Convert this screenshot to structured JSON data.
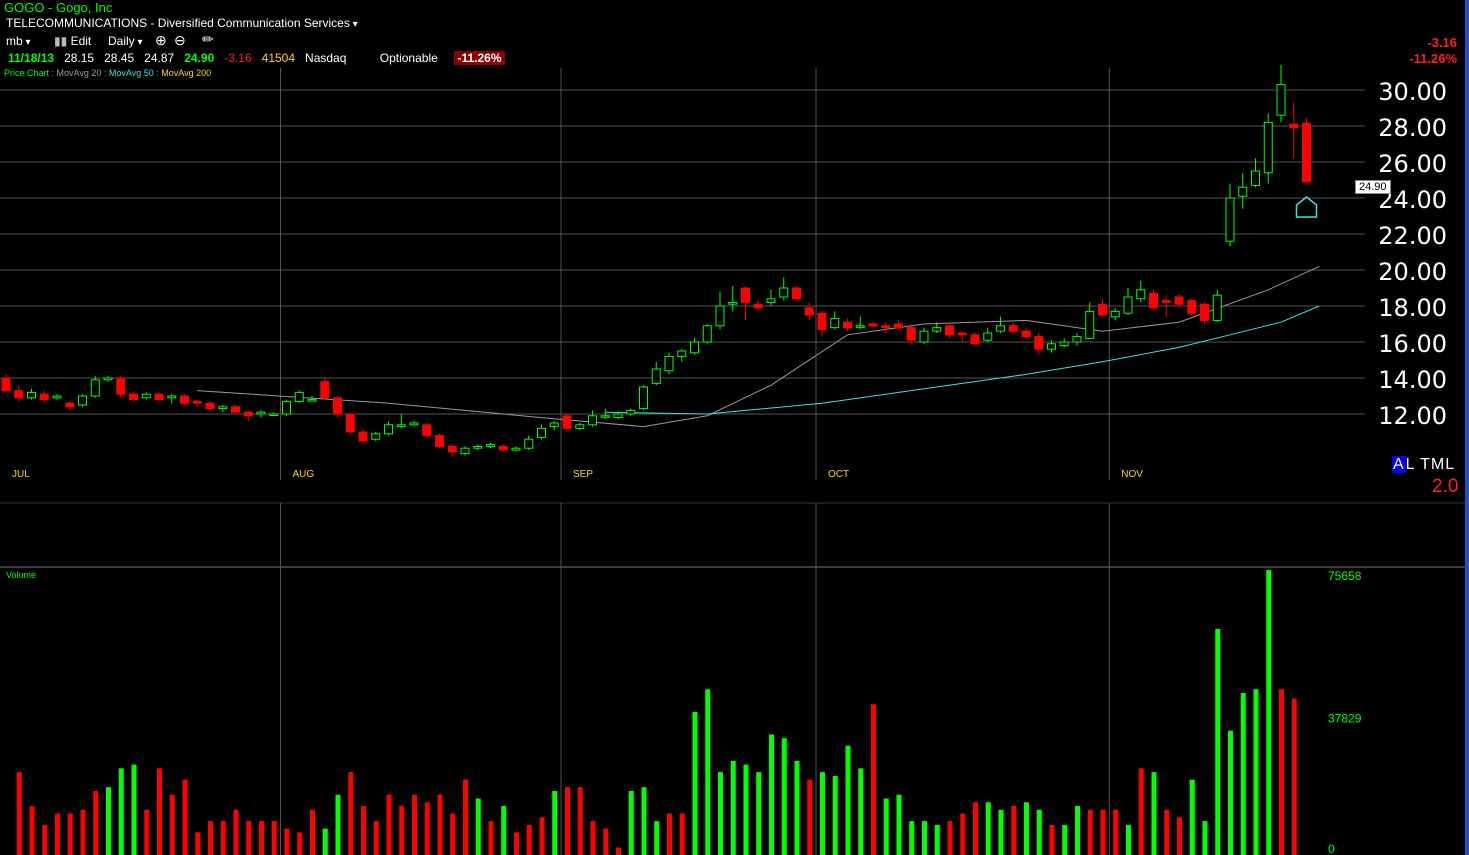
{
  "header": {
    "title": "GOGO - Gogo, Inc",
    "sector": "TELECOMMUNICATIONS - Diversified Communication Services",
    "user": "mb",
    "edit_label": "Edit",
    "interval": "Daily",
    "date": "11/18/13",
    "open": "28.15",
    "high": "28.45",
    "low": "24.87",
    "close": "24.90",
    "change": "-3.16",
    "volume": "41504",
    "exchange": "Nasdaq",
    "optionable": "Optionable",
    "pct_change": "-11.26%"
  },
  "legend": {
    "price_chart": "Price Chart",
    "ma20": "MovAvg 20",
    "ma50": "MovAvg 50",
    "ma200": "MovAvg 200",
    "volume": "Volume"
  },
  "right_panel": {
    "change": "-3.16",
    "pct_change": "-11.26%",
    "last_price_tag": "24.90",
    "altml_a": "A",
    "altml_rest": "L TML",
    "altml_value": "2.0"
  },
  "colors": {
    "up": "#00ff00",
    "down": "#ff0000",
    "ma20": "#9a9a9a",
    "ma50": "#40e0e0",
    "grid": "#555555"
  },
  "chart_data": {
    "type": "candlestick",
    "price_axis": {
      "ylim": [
        10.6,
        31.6
      ],
      "ticks": [
        "30.00",
        "28.00",
        "26.00",
        "24.00",
        "22.00",
        "20.00",
        "18.00",
        "16.00",
        "14.00",
        "12.00"
      ]
    },
    "volume_axis": {
      "ylim": [
        0,
        75658
      ],
      "ticks": [
        "75658",
        "37829",
        "0"
      ]
    },
    "months": [
      {
        "label": "JUL",
        "index": 0
      },
      {
        "label": "AUG",
        "index": 22
      },
      {
        "label": "SEP",
        "index": 44
      },
      {
        "label": "OCT",
        "index": 64
      },
      {
        "label": "NOV",
        "index": 87
      }
    ],
    "candles": [
      [
        14.0,
        13.3,
        14.2,
        13.2
      ],
      [
        13.3,
        12.9,
        13.6,
        12.7
      ],
      [
        12.9,
        13.2,
        13.4,
        12.8
      ],
      [
        13.1,
        12.8,
        13.3,
        12.6
      ],
      [
        12.9,
        13.0,
        13.1,
        12.8
      ],
      [
        12.6,
        12.4,
        12.7,
        12.2
      ],
      [
        12.5,
        13.0,
        13.1,
        12.4
      ],
      [
        13.0,
        13.9,
        14.1,
        12.9
      ],
      [
        13.9,
        14.0,
        14.1,
        13.8
      ],
      [
        14.0,
        13.1,
        14.1,
        12.9
      ],
      [
        13.1,
        12.8,
        13.2,
        12.7
      ],
      [
        12.9,
        13.1,
        13.2,
        12.8
      ],
      [
        13.1,
        12.8,
        13.2,
        12.7
      ],
      [
        12.9,
        13.0,
        13.1,
        12.6
      ],
      [
        13.0,
        12.6,
        13.1,
        12.5
      ],
      [
        12.7,
        12.6,
        12.8,
        12.4
      ],
      [
        12.6,
        12.3,
        12.7,
        12.2
      ],
      [
        12.3,
        12.4,
        12.5,
        12.1
      ],
      [
        12.4,
        12.1,
        12.5,
        12.0
      ],
      [
        12.1,
        11.9,
        12.2,
        11.6
      ],
      [
        12.0,
        12.1,
        12.2,
        11.8
      ],
      [
        12.0,
        12.0,
        12.1,
        11.9
      ],
      [
        12.0,
        12.7,
        12.8,
        11.9
      ],
      [
        12.7,
        13.2,
        13.3,
        12.6
      ],
      [
        12.8,
        12.8,
        13.0,
        12.7
      ],
      [
        13.8,
        12.9,
        14.0,
        12.8
      ],
      [
        12.9,
        12.0,
        13.0,
        11.8
      ],
      [
        12.0,
        11.0,
        12.1,
        10.9
      ],
      [
        11.0,
        10.5,
        11.2,
        10.4
      ],
      [
        10.6,
        10.9,
        11.0,
        10.5
      ],
      [
        10.9,
        11.4,
        11.6,
        10.8
      ],
      [
        11.3,
        11.4,
        12.0,
        11.2
      ],
      [
        11.4,
        11.5,
        11.6,
        11.3
      ],
      [
        11.4,
        10.8,
        11.5,
        10.7
      ],
      [
        10.8,
        10.2,
        10.9,
        10.1
      ],
      [
        10.2,
        9.9,
        10.3,
        9.6
      ],
      [
        9.8,
        10.1,
        10.2,
        9.7
      ],
      [
        10.1,
        10.2,
        10.3,
        10.0
      ],
      [
        10.2,
        10.3,
        10.4,
        10.1
      ],
      [
        10.2,
        10.0,
        10.3,
        9.9
      ],
      [
        10.0,
        10.1,
        10.2,
        9.9
      ],
      [
        10.1,
        10.6,
        10.8,
        10.0
      ],
      [
        10.7,
        11.2,
        11.4,
        10.6
      ],
      [
        11.3,
        11.5,
        11.6,
        11.1
      ],
      [
        11.9,
        11.2,
        12.0,
        11.0
      ],
      [
        11.2,
        11.4,
        11.5,
        11.1
      ],
      [
        11.4,
        11.9,
        12.2,
        11.3
      ],
      [
        11.9,
        11.9,
        12.3,
        11.7
      ],
      [
        11.8,
        12.0,
        12.1,
        11.7
      ],
      [
        12.0,
        12.2,
        12.3,
        11.9
      ],
      [
        12.3,
        13.5,
        13.6,
        12.2
      ],
      [
        13.7,
        14.5,
        14.9,
        13.6
      ],
      [
        14.4,
        15.2,
        15.4,
        14.2
      ],
      [
        15.2,
        15.5,
        15.6,
        14.9
      ],
      [
        15.4,
        16.0,
        16.2,
        15.3
      ],
      [
        16.0,
        16.9,
        17.0,
        15.9
      ],
      [
        16.9,
        18.0,
        18.8,
        16.7
      ],
      [
        18.1,
        18.2,
        19.1,
        17.7
      ],
      [
        19.0,
        18.2,
        19.1,
        17.2
      ],
      [
        18.1,
        17.9,
        18.3,
        17.8
      ],
      [
        18.2,
        18.4,
        18.9,
        18.0
      ],
      [
        18.5,
        19.0,
        19.6,
        18.3
      ],
      [
        19.0,
        18.4,
        19.1,
        18.3
      ],
      [
        17.9,
        17.5,
        18.2,
        17.2
      ],
      [
        17.6,
        16.7,
        17.7,
        16.3
      ],
      [
        16.8,
        17.3,
        17.7,
        16.7
      ],
      [
        17.1,
        16.8,
        17.3,
        16.6
      ],
      [
        16.9,
        16.9,
        17.4,
        16.7
      ],
      [
        17.0,
        16.9,
        17.1,
        16.8
      ],
      [
        16.9,
        16.8,
        17.1,
        16.5
      ],
      [
        17.0,
        16.8,
        17.2,
        16.7
      ],
      [
        16.8,
        16.1,
        17.0,
        15.9
      ],
      [
        16.0,
        16.6,
        16.8,
        15.9
      ],
      [
        16.6,
        16.8,
        17.1,
        16.5
      ],
      [
        16.9,
        16.4,
        17.0,
        16.2
      ],
      [
        16.5,
        16.4,
        16.6,
        16.0
      ],
      [
        16.4,
        15.9,
        16.5,
        15.8
      ],
      [
        16.1,
        16.5,
        16.8,
        16.0
      ],
      [
        16.6,
        16.9,
        17.4,
        16.5
      ],
      [
        16.9,
        16.6,
        17.1,
        16.5
      ],
      [
        16.6,
        16.3,
        16.8,
        16.2
      ],
      [
        16.3,
        15.6,
        16.5,
        15.3
      ],
      [
        15.6,
        15.9,
        16.1,
        15.4
      ],
      [
        15.8,
        16.0,
        16.2,
        15.7
      ],
      [
        16.0,
        16.3,
        16.5,
        15.8
      ],
      [
        16.2,
        17.7,
        18.2,
        16.2
      ],
      [
        18.1,
        17.5,
        18.4,
        17.4
      ],
      [
        17.4,
        17.7,
        17.9,
        17.2
      ],
      [
        17.6,
        18.5,
        19.0,
        17.5
      ],
      [
        18.4,
        18.9,
        19.4,
        18.2
      ],
      [
        18.7,
        17.9,
        18.9,
        17.8
      ],
      [
        18.3,
        18.2,
        18.6,
        17.4
      ],
      [
        18.5,
        18.1,
        18.7,
        17.9
      ],
      [
        18.3,
        17.6,
        18.4,
        17.5
      ],
      [
        18.1,
        17.2,
        18.2,
        17.0
      ],
      [
        17.2,
        18.6,
        18.9,
        17.1
      ],
      [
        21.6,
        24.0,
        24.8,
        21.3
      ],
      [
        24.1,
        24.6,
        25.4,
        23.4
      ],
      [
        24.7,
        25.5,
        26.2,
        24.6
      ],
      [
        25.4,
        28.2,
        28.7,
        24.8
      ],
      [
        28.6,
        30.3,
        31.4,
        28.2
      ],
      [
        28.1,
        27.9,
        29.3,
        26.2
      ],
      [
        28.15,
        24.9,
        28.45,
        24.87
      ]
    ],
    "volume": [
      [
        0,
        0
      ],
      [
        22000,
        0
      ],
      [
        13000,
        0
      ],
      [
        8000,
        0
      ],
      [
        11000,
        0
      ],
      [
        11000,
        0
      ],
      [
        12000,
        0
      ],
      [
        17000,
        0
      ],
      [
        18000,
        1
      ],
      [
        23000,
        1
      ],
      [
        24000,
        1
      ],
      [
        12000,
        0
      ],
      [
        23000,
        0
      ],
      [
        16000,
        0
      ],
      [
        20000,
        0
      ],
      [
        6000,
        0
      ],
      [
        9000,
        0
      ],
      [
        9000,
        0
      ],
      [
        12000,
        0
      ],
      [
        9000,
        0
      ],
      [
        9000,
        0
      ],
      [
        9000,
        0
      ],
      [
        7000,
        0
      ],
      [
        6000,
        0
      ],
      [
        12000,
        0
      ],
      [
        7000,
        1
      ],
      [
        16000,
        1
      ],
      [
        22000,
        0
      ],
      [
        13000,
        0
      ],
      [
        9000,
        0
      ],
      [
        16000,
        0
      ],
      [
        13000,
        0
      ],
      [
        16000,
        0
      ],
      [
        14000,
        0
      ],
      [
        16000,
        0
      ],
      [
        11000,
        0
      ],
      [
        20000,
        0
      ],
      [
        15000,
        1
      ],
      [
        9000,
        0
      ],
      [
        13000,
        1
      ],
      [
        6000,
        0
      ],
      [
        8000,
        0
      ],
      [
        10000,
        0
      ],
      [
        17000,
        1
      ],
      [
        18000,
        0
      ],
      [
        18000,
        0
      ],
      [
        9000,
        0
      ],
      [
        7000,
        0
      ],
      [
        2000,
        0
      ],
      [
        17000,
        1
      ],
      [
        18000,
        1
      ],
      [
        9000,
        1
      ],
      [
        11000,
        0
      ],
      [
        11000,
        0
      ],
      [
        38000,
        1
      ],
      [
        44000,
        1
      ],
      [
        22000,
        1
      ],
      [
        25000,
        1
      ],
      [
        24000,
        1
      ],
      [
        22000,
        1
      ],
      [
        32000,
        1
      ],
      [
        31000,
        1
      ],
      [
        25000,
        1
      ],
      [
        20000,
        0
      ],
      [
        22000,
        1
      ],
      [
        21000,
        1
      ],
      [
        29000,
        1
      ],
      [
        23000,
        1
      ],
      [
        40000,
        0
      ],
      [
        15000,
        1
      ],
      [
        16000,
        1
      ],
      [
        9000,
        1
      ],
      [
        9000,
        1
      ],
      [
        8000,
        1
      ],
      [
        9000,
        0
      ],
      [
        11000,
        0
      ],
      [
        14000,
        0
      ],
      [
        14000,
        1
      ],
      [
        12000,
        1
      ],
      [
        13000,
        0
      ],
      [
        14000,
        1
      ],
      [
        12000,
        1
      ],
      [
        8000,
        0
      ],
      [
        8000,
        1
      ],
      [
        13000,
        1
      ],
      [
        12000,
        0
      ],
      [
        12000,
        0
      ],
      [
        12000,
        0
      ],
      [
        8000,
        1
      ],
      [
        23000,
        0
      ],
      [
        22000,
        1
      ],
      [
        12000,
        0
      ],
      [
        10000,
        0
      ],
      [
        20000,
        1
      ],
      [
        9000,
        1
      ],
      [
        60000,
        1
      ],
      [
        33000,
        1
      ],
      [
        43000,
        1
      ],
      [
        44000,
        1
      ],
      [
        75658,
        1
      ],
      [
        44000,
        0
      ],
      [
        41504,
        0
      ]
    ],
    "ma20": [
      [
        15,
        13.3
      ],
      [
        30,
        12.6
      ],
      [
        42,
        11.8
      ],
      [
        50,
        11.3
      ],
      [
        55,
        11.9
      ],
      [
        60,
        13.6
      ],
      [
        66,
        16.4
      ],
      [
        72,
        17.0
      ],
      [
        80,
        17.2
      ],
      [
        86,
        16.6
      ],
      [
        92,
        17.1
      ],
      [
        99,
        18.9
      ],
      [
        103,
        20.2
      ]
    ],
    "ma50": [
      [
        47,
        12.1
      ],
      [
        55,
        12.0
      ],
      [
        64,
        12.6
      ],
      [
        72,
        13.4
      ],
      [
        80,
        14.2
      ],
      [
        86,
        14.9
      ],
      [
        92,
        15.7
      ],
      [
        96,
        16.4
      ],
      [
        100,
        17.1
      ],
      [
        103,
        18.0
      ]
    ]
  }
}
